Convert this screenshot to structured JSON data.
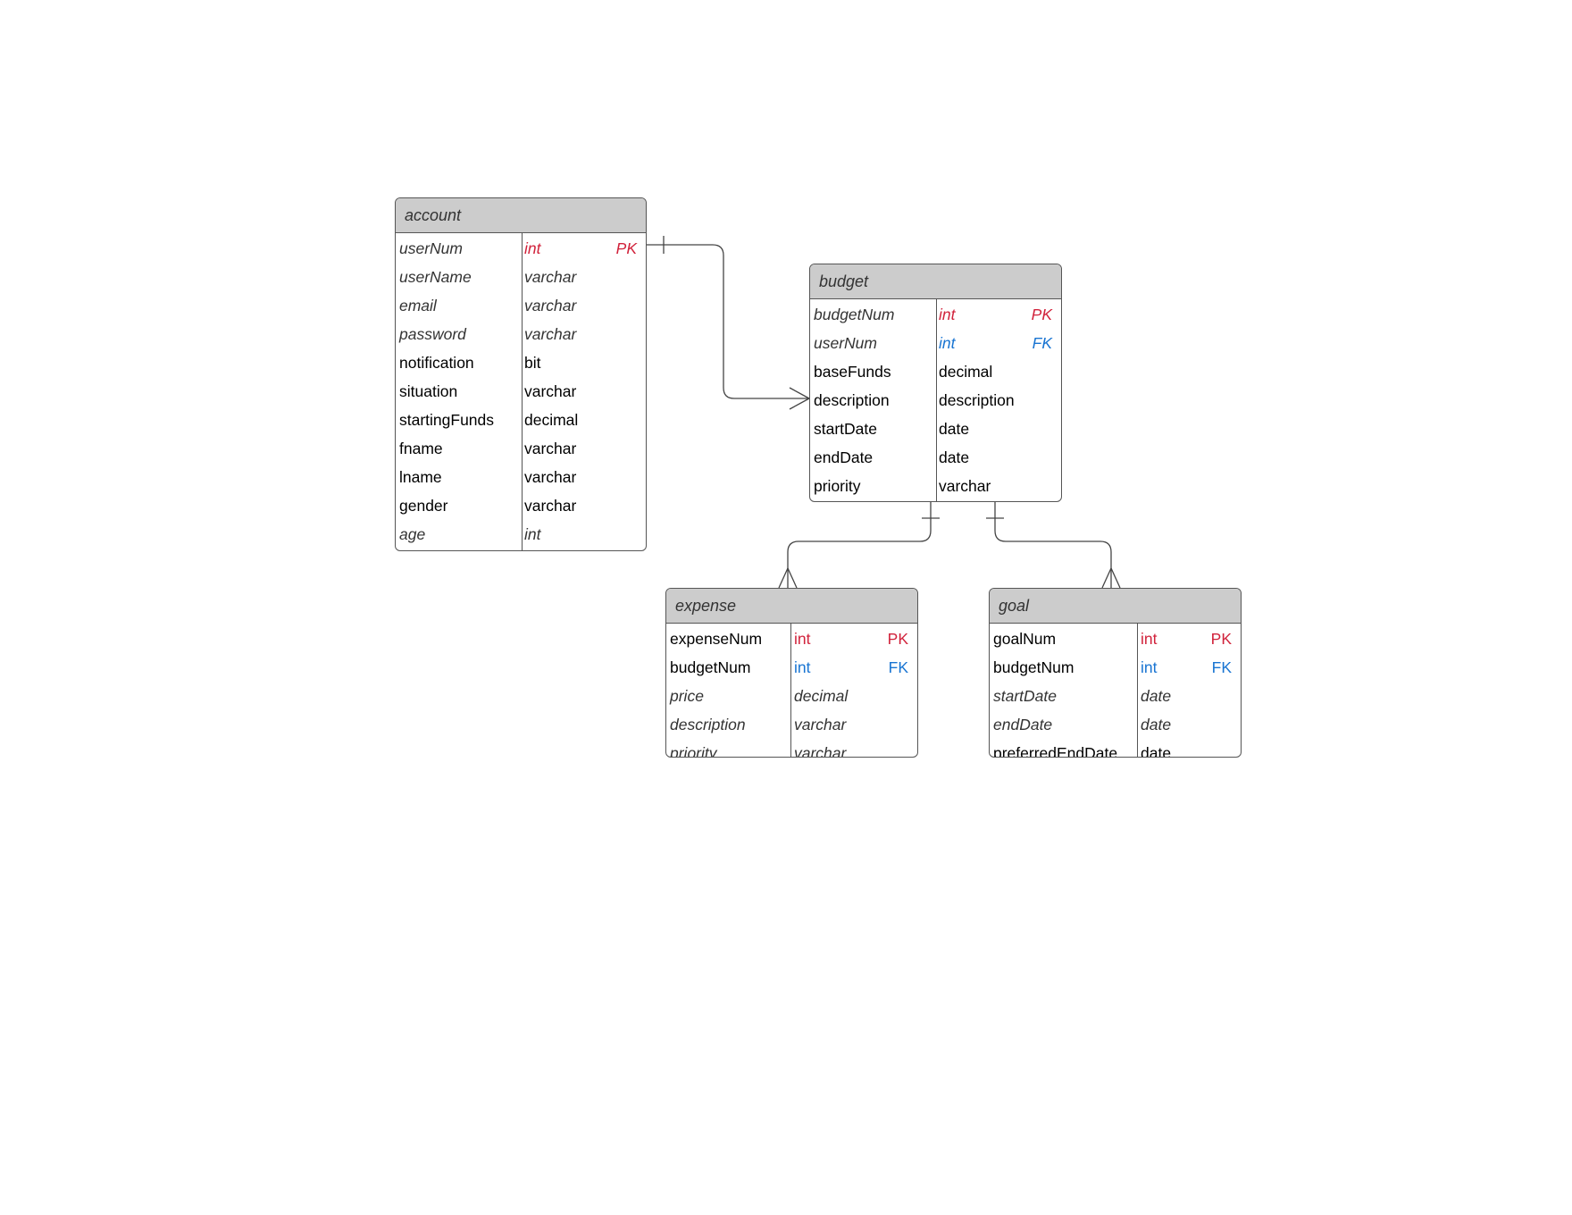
{
  "diagram": {
    "entities": {
      "account": {
        "name": "account",
        "fields": [
          {
            "name": "userNum",
            "type": "int",
            "key": "PK",
            "italic": true
          },
          {
            "name": "userName",
            "type": "varchar",
            "key": "",
            "italic": true
          },
          {
            "name": "email",
            "type": "varchar",
            "key": "",
            "italic": true
          },
          {
            "name": "password",
            "type": "varchar",
            "key": "",
            "italic": true
          },
          {
            "name": "notification",
            "type": "bit",
            "key": "",
            "italic": false
          },
          {
            "name": "situation",
            "type": "varchar",
            "key": "",
            "italic": false
          },
          {
            "name": "startingFunds",
            "type": "decimal",
            "key": "",
            "italic": false
          },
          {
            "name": "fname",
            "type": "varchar",
            "key": "",
            "italic": false
          },
          {
            "name": "lname",
            "type": "varchar",
            "key": "",
            "italic": false
          },
          {
            "name": "gender",
            "type": "varchar",
            "key": "",
            "italic": false
          },
          {
            "name": "age",
            "type": "int",
            "key": "",
            "italic": true
          }
        ]
      },
      "budget": {
        "name": "budget",
        "fields": [
          {
            "name": "budgetNum",
            "type": "int",
            "key": "PK",
            "italic": true
          },
          {
            "name": "userNum",
            "type": "int",
            "key": "FK",
            "italic": true
          },
          {
            "name": "baseFunds",
            "type": "decimal",
            "key": "",
            "italic": false
          },
          {
            "name": "description",
            "type": "description",
            "key": "",
            "italic": false
          },
          {
            "name": "startDate",
            "type": "date",
            "key": "",
            "italic": false
          },
          {
            "name": "endDate",
            "type": "date",
            "key": "",
            "italic": false
          },
          {
            "name": "priority",
            "type": "varchar",
            "key": "",
            "italic": false
          }
        ]
      },
      "expense": {
        "name": "expense",
        "fields": [
          {
            "name": "expenseNum",
            "type": "int",
            "key": "PK",
            "italic": false
          },
          {
            "name": "budgetNum",
            "type": "int",
            "key": "FK",
            "italic": false
          },
          {
            "name": "price",
            "type": "decimal",
            "key": "",
            "italic": true
          },
          {
            "name": "description",
            "type": "varchar",
            "key": "",
            "italic": true
          },
          {
            "name": "priority",
            "type": "varchar",
            "key": "",
            "italic": true
          }
        ]
      },
      "goal": {
        "name": "goal",
        "fields": [
          {
            "name": "goalNum",
            "type": "int",
            "key": "PK",
            "italic": false
          },
          {
            "name": "budgetNum",
            "type": "int",
            "key": "FK",
            "italic": false
          },
          {
            "name": "startDate",
            "type": "date",
            "key": "",
            "italic": true
          },
          {
            "name": "endDate",
            "type": "date",
            "key": "",
            "italic": true
          },
          {
            "name": "preferredEndDate",
            "type": "date",
            "key": "",
            "italic": false
          }
        ]
      }
    },
    "relationships": [
      {
        "from": "account",
        "to": "budget",
        "from_cardinality": "one",
        "to_cardinality": "many"
      },
      {
        "from": "budget",
        "to": "expense",
        "from_cardinality": "one",
        "to_cardinality": "many"
      },
      {
        "from": "budget",
        "to": "goal",
        "from_cardinality": "one",
        "to_cardinality": "many"
      }
    ],
    "colors": {
      "pk": "#d1223b",
      "fk": "#1874d2",
      "header_bg": "#cccccc",
      "border": "#555555"
    }
  }
}
